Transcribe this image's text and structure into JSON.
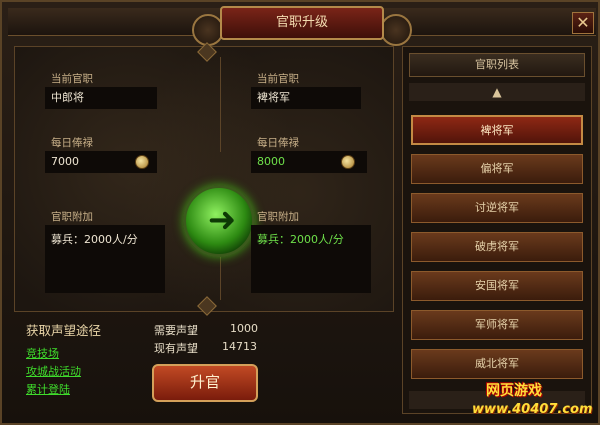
{
  "window": {
    "title": "官职升级",
    "close_glyph": "✕"
  },
  "current": {
    "rank_label": "当前官职",
    "rank_value": "中郎将",
    "salary_label": "每日俸禄",
    "salary_value": "7000",
    "bonus_label": "官职附加",
    "bonus_value": "募兵：2000人/分"
  },
  "next": {
    "rank_label": "当前官职",
    "rank_value": "裨将军",
    "salary_label": "每日俸禄",
    "salary_value": "8000",
    "bonus_label": "官职附加",
    "bonus_value": "募兵：2000人/分"
  },
  "prestige": {
    "title": "获取声望途径",
    "links": [
      "竞技场",
      "攻城战活动",
      "累计登陆"
    ],
    "required_label": "需要声望",
    "required_value": "1000",
    "current_label": "现有声望",
    "current_value": "14713"
  },
  "promote_button": "升官",
  "rank_list": {
    "header": "官职列表",
    "items": [
      "裨将军",
      "偏将军",
      "讨逆将军",
      "破虏将军",
      "安国将军",
      "军师将军",
      "威北将军"
    ],
    "selected_index": 0
  },
  "watermark": {
    "line1": "网页游戏",
    "line2": "www.40407.com"
  },
  "icons": {
    "arrow": "arrow-right-icon",
    "coin": "coin-icon",
    "scroll_up": "chevron-up-icon"
  },
  "colors": {
    "accent_green": "#6ee04a",
    "link_green": "#3fdc2c",
    "gold": "#d4a05a",
    "red": "#8e2814"
  }
}
